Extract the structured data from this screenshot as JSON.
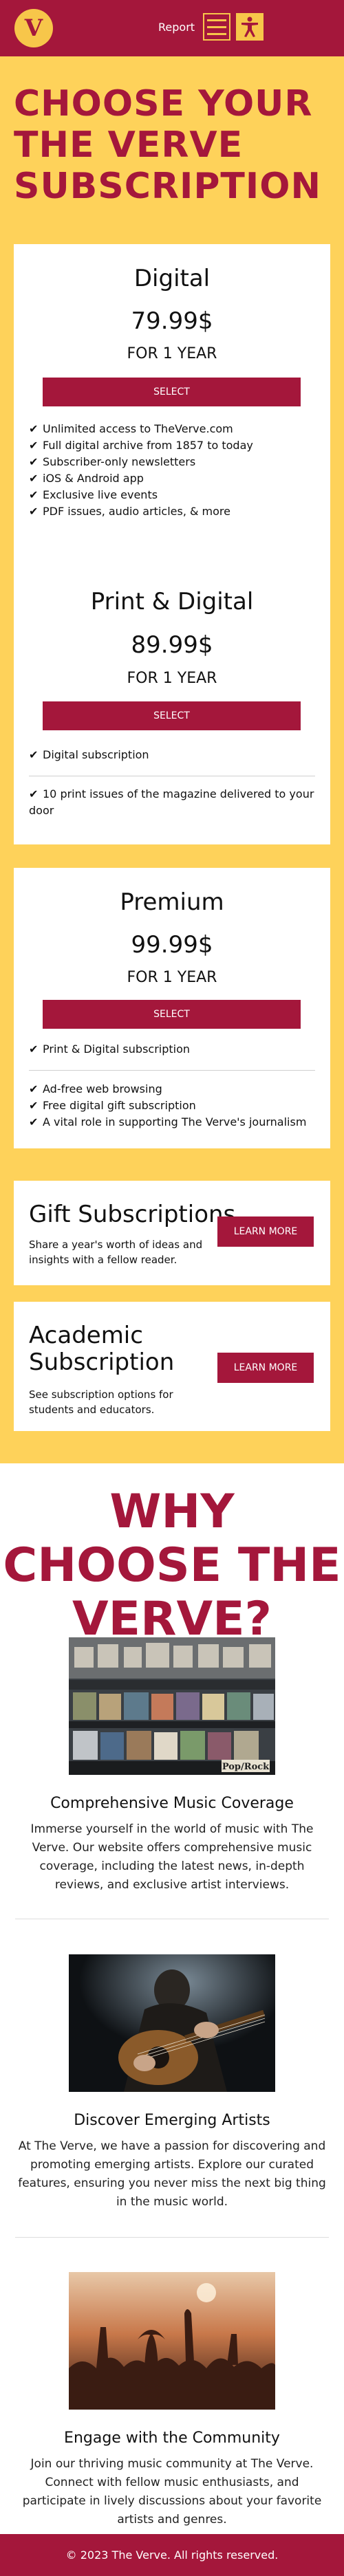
{
  "header": {
    "logo_letter": "V",
    "report_label": "Report",
    "menu_icon": "hamburger-icon",
    "accessibility_icon": "accessibility-icon"
  },
  "subscription": {
    "title": "CHOOSE YOUR THE VERVE SUBSCRIPTION",
    "plans": [
      {
        "name": "Digital",
        "price": "79.99$",
        "term": "FOR 1 YEAR",
        "button": "SELECT",
        "features": [
          "Unlimited access to TheVerve.com",
          "Full digital archive from 1857 to today",
          "Subscriber-only newsletters",
          "iOS & Android app",
          "Exclusive live events",
          "PDF issues, audio articles, & more"
        ]
      },
      {
        "name": "Print & Digital",
        "price": "89.99$",
        "term": "FOR 1 YEAR",
        "button": "SELECT",
        "features_top": [
          "Digital subscription"
        ],
        "features": [
          "10 print issues of the magazine delivered to your door"
        ]
      },
      {
        "name": "Premium",
        "price": "99.99$",
        "term": "FOR 1 YEAR",
        "button": "SELECT",
        "features_top": [
          "Print & Digital subscription"
        ],
        "features": [
          "Ad-free web browsing",
          "Free digital gift subscription",
          "A vital role in supporting The Verve's journalism"
        ]
      }
    ],
    "gift": {
      "title": "Gift Subscriptions",
      "desc": "Share a year's worth of ideas and insights with a fellow reader.",
      "button": "LEARN MORE"
    },
    "academic": {
      "title": "Academic Subscription",
      "desc": "See subscription options for students and educators.",
      "button": "LEARN MORE"
    }
  },
  "why": {
    "title": "WHY CHOOSE THE VERVE?",
    "features": [
      {
        "title": "Comprehensive Music Coverage",
        "desc": "Immerse yourself in the world of music with The Verve. Our website offers comprehensive music coverage, including the latest news, in-depth reviews, and exclusive artist interviews.",
        "image_sign": "Pop/Rock"
      },
      {
        "title": "Discover Emerging Artists",
        "desc": "At The Verve, we have a passion for discovering and promoting emerging artists. Explore our curated features, ensuring you never miss the next big thing in the music world."
      },
      {
        "title": "Engage with the Community",
        "desc": "Join our thriving music community at The Verve. Connect with fellow music enthusiasts, and participate in lively discussions about your favorite artists and genres."
      }
    ]
  },
  "footer": {
    "copyright": "© 2023 The Verve. All rights reserved."
  },
  "colors": {
    "brand_red": "#a4173b",
    "brand_yellow": "#fed25a"
  }
}
